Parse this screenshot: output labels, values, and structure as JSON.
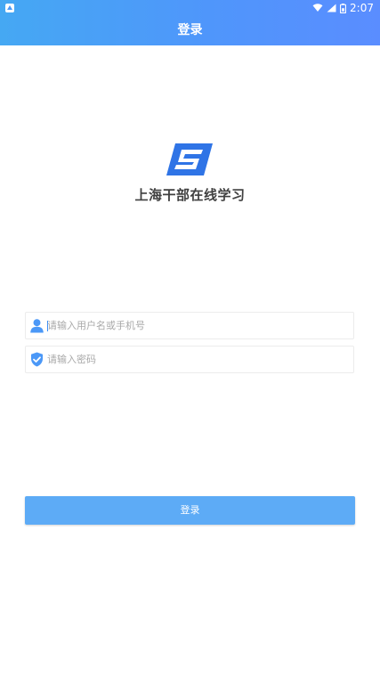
{
  "status_bar": {
    "time": "2:07",
    "icons": [
      "notification-icon",
      "wifi-icon",
      "cellular-signal-icon",
      "battery-icon"
    ]
  },
  "header": {
    "title": "登录",
    "gradient_start": "#45a8f3",
    "gradient_end": "#5a8dff"
  },
  "brand": {
    "app_name": "上海干部在线学习",
    "logo_icon": "shanghai-cadre-logo-icon",
    "logo_color": "#2f74e6"
  },
  "login_form": {
    "username": {
      "icon": "user-icon",
      "placeholder": "请输入用户名或手机号",
      "value": ""
    },
    "password": {
      "icon": "shield-check-icon",
      "placeholder": "请输入密码",
      "value": ""
    },
    "submit_label": "登录",
    "submit_color": "#5dabf6"
  }
}
